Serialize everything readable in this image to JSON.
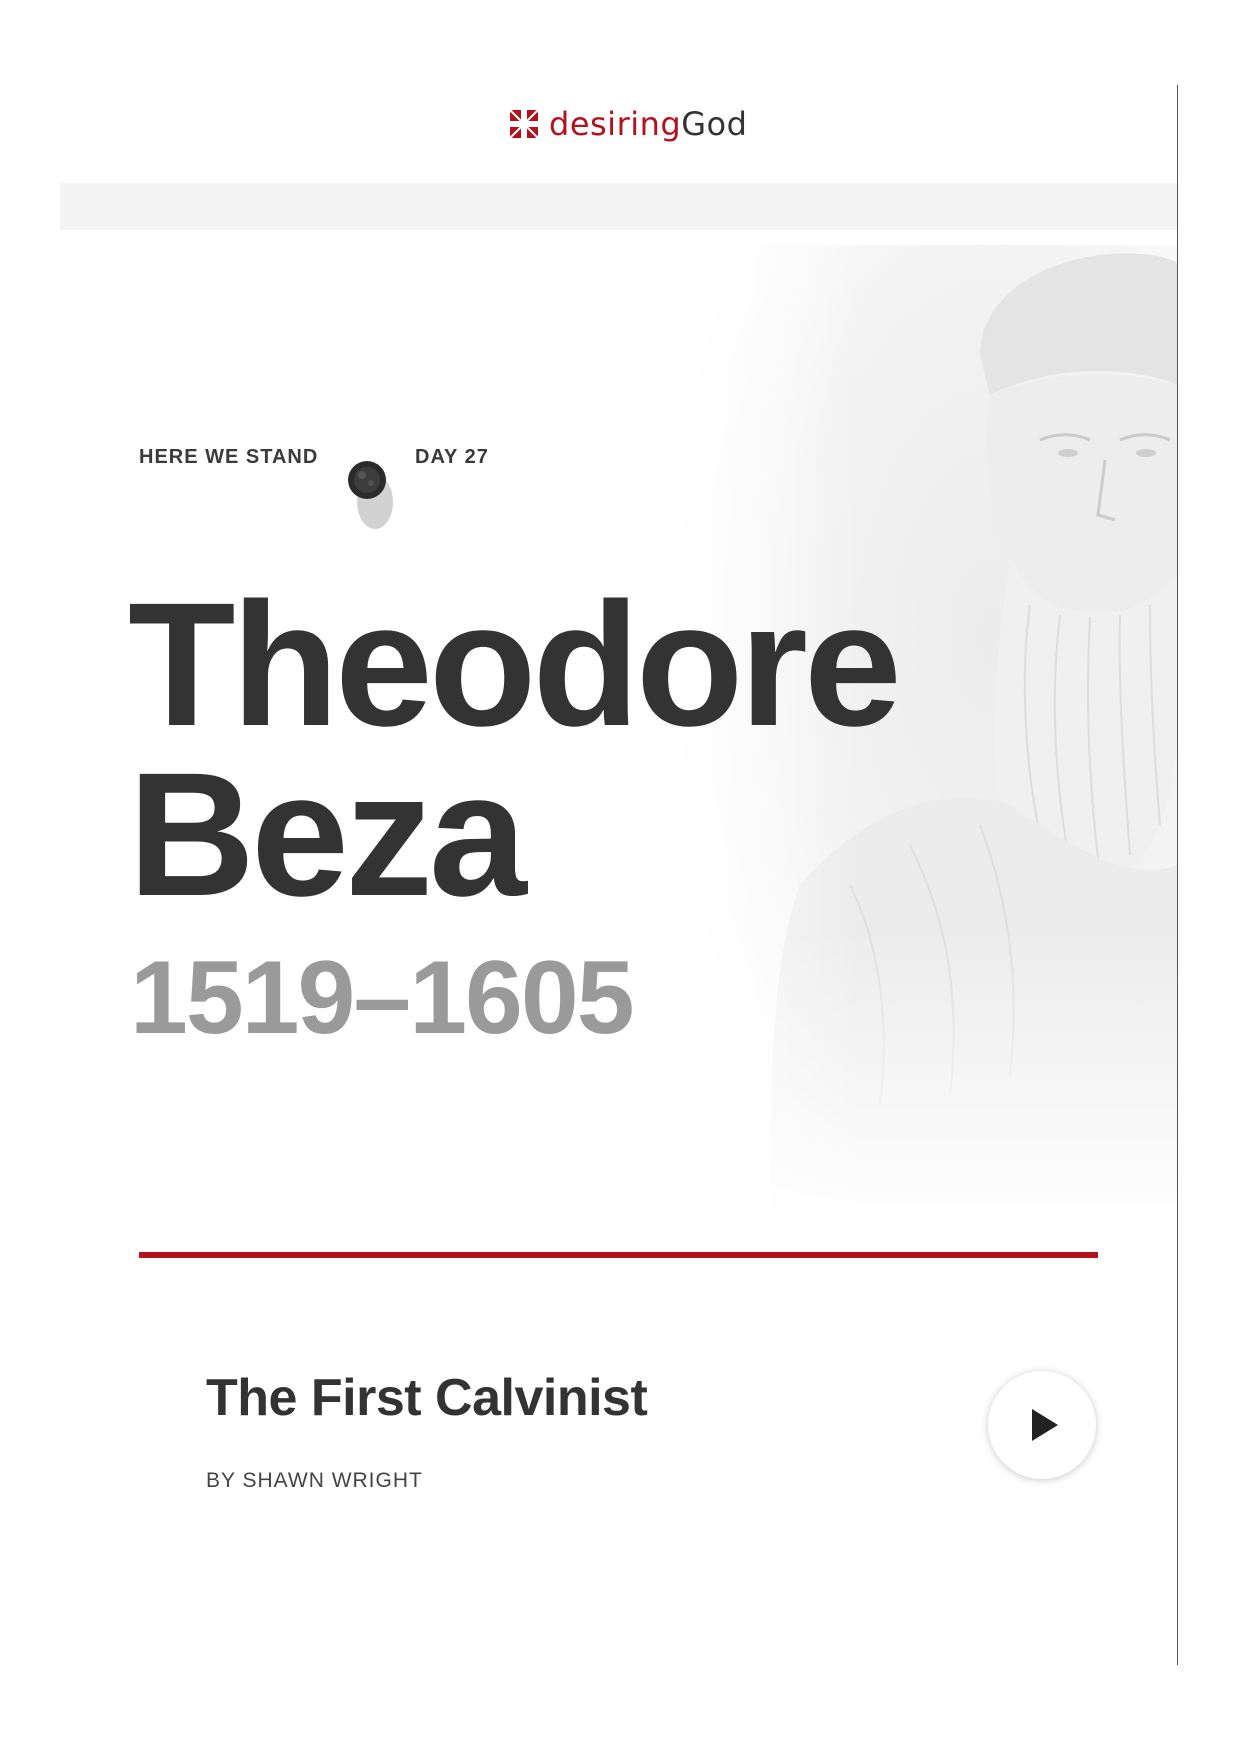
{
  "brand": {
    "logo_mark_icon": "cross-grid-icon",
    "name_part1": "desiring",
    "name_part2": "God",
    "accent_color": "#b3121d"
  },
  "series": {
    "name": "HERE WE STAND",
    "day": "DAY 27",
    "seal_icon": "wax-seal-icon"
  },
  "hero": {
    "title_line1": "Theodore",
    "title_line2": "Beza",
    "years": "1519–1605",
    "portrait_icon": "reformer-portrait-illustration"
  },
  "article": {
    "title": "The First Calvinist",
    "byline": "BY SHAWN WRIGHT",
    "play_icon": "play-icon"
  }
}
